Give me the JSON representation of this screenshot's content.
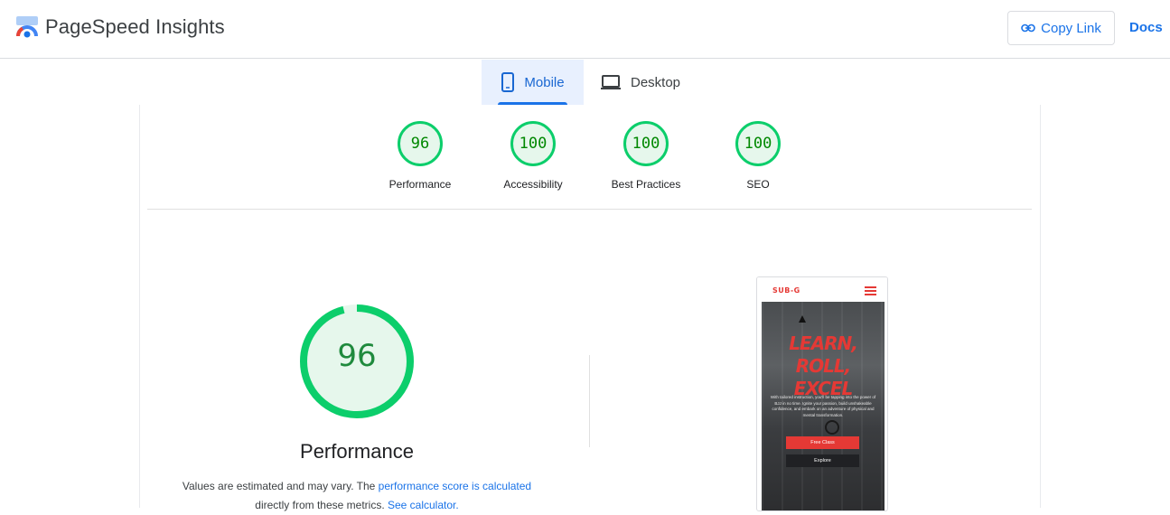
{
  "header": {
    "title": "PageSpeed Insights",
    "copy_link_label": "Copy Link",
    "docs_label": "Docs"
  },
  "tabs": [
    {
      "label": "Mobile",
      "active": true
    },
    {
      "label": "Desktop",
      "active": false
    }
  ],
  "scores": [
    {
      "value": "96",
      "label": "Performance"
    },
    {
      "value": "100",
      "label": "Accessibility"
    },
    {
      "value": "100",
      "label": "Best Practices"
    },
    {
      "value": "100",
      "label": "SEO"
    }
  ],
  "performance": {
    "score": "96",
    "score_fraction": 0.96,
    "title": "Performance",
    "desc_prefix": "Values are estimated and may vary. The ",
    "desc_link1": "performance score is calculated",
    "desc_middle": " directly from these metrics. ",
    "desc_link2": "See calculator.",
    "desc_suffix": ""
  },
  "preview": {
    "brand": "SUB-G",
    "headline_line1": "LEARN, ROLL,",
    "headline_line2": "EXCEL",
    "body": "With tailored instruction, you'll be tapping into the power of BJJ in no time. Ignite your passion, build unshakeable confidence, and embark on an adventure of physical and mental transformation.",
    "primary_button": "Free Class",
    "secondary_button": "Explore"
  },
  "colors": {
    "good": "#0cce6b",
    "good_bg": "#e6f7ec",
    "good_text": "#008800",
    "accent": "#1a73e8",
    "brand_red": "#e53935"
  }
}
